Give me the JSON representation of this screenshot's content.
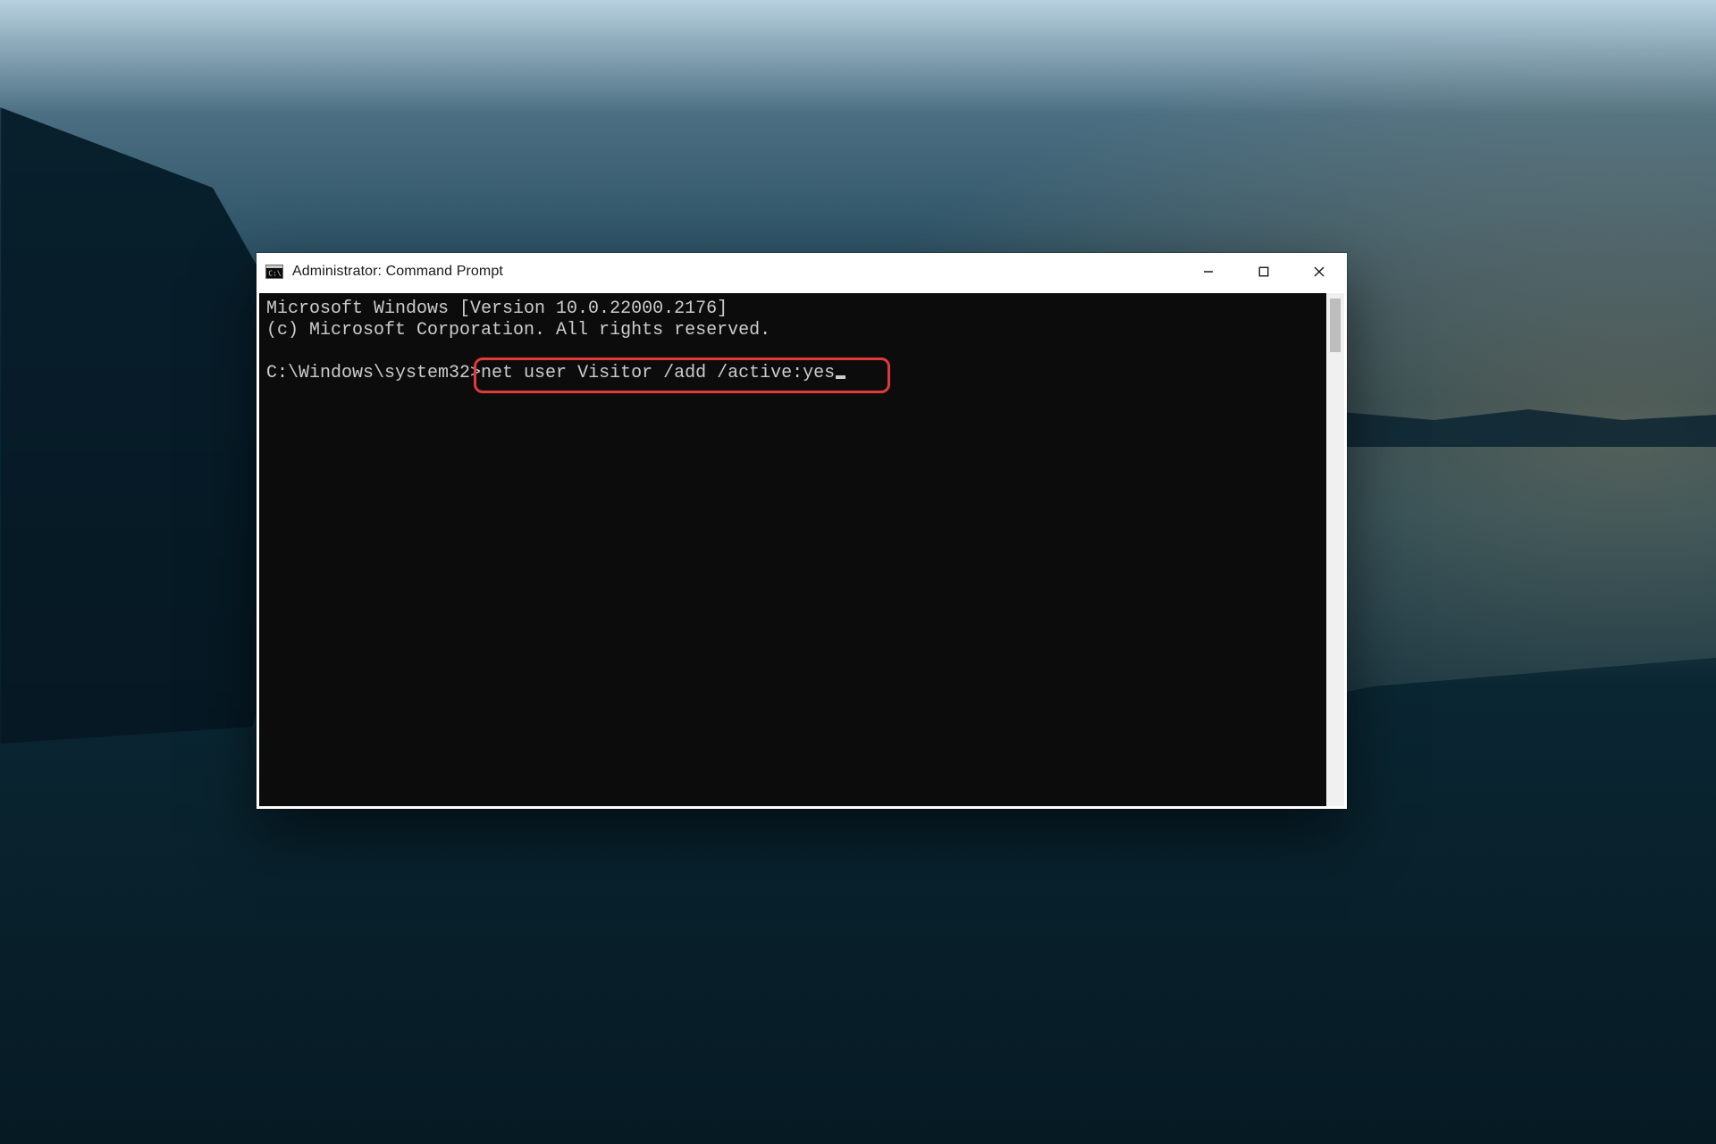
{
  "window": {
    "title": "Administrator: Command Prompt",
    "icon": "cmd-icon"
  },
  "controls": {
    "minimize_label": "Minimize",
    "maximize_label": "Maximize",
    "close_label": "Close"
  },
  "terminal": {
    "line1": "Microsoft Windows [Version 10.0.22000.2176]",
    "line2": "(c) Microsoft Corporation. All rights reserved.",
    "prompt": "C:\\Windows\\system32>",
    "command": "net user Visitor /add /active:yes",
    "highlight_color": "#e03b3b"
  }
}
